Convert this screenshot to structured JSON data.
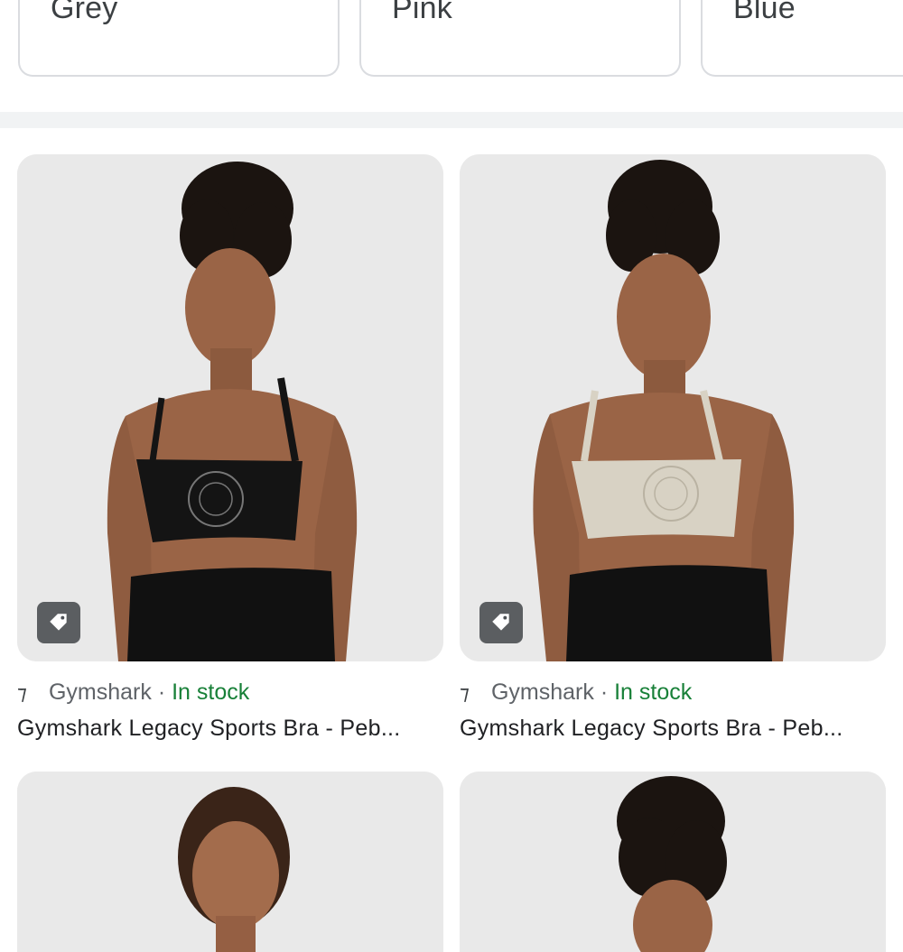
{
  "color_filters": [
    {
      "label": "Grey"
    },
    {
      "label": "Pink"
    },
    {
      "label": "Blue"
    }
  ],
  "products": [
    {
      "merchant": "Gymshark",
      "separator": "·",
      "availability": "In stock",
      "title": "Gymshark Legacy Sports Bra - Peb...",
      "bra_color": "#141414",
      "tag_icon": "price-tag-icon",
      "merchant_logo_icon": "gymshark-logo-icon"
    },
    {
      "merchant": "Gymshark",
      "separator": "·",
      "availability": "In stock",
      "title": "Gymshark Legacy Sports Bra - Peb...",
      "bra_color": "#d8d2c4",
      "tag_icon": "price-tag-icon",
      "merchant_logo_icon": "gymshark-logo-icon"
    }
  ],
  "colors": {
    "in_stock": "#188038",
    "merchant_text": "#5f6368",
    "chip_border": "#dadce0",
    "image_background": "#e9e9e9",
    "skin_tone": "#9a6446",
    "hair": "#1b1410",
    "leggings": "#111111"
  }
}
